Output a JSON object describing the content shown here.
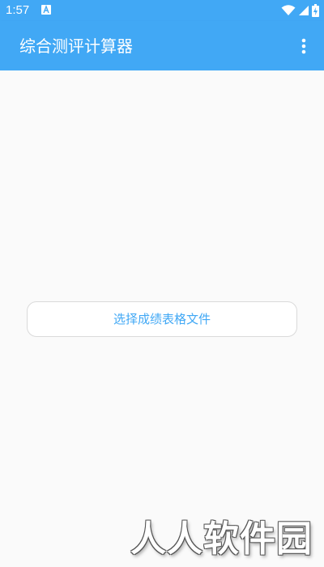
{
  "status_bar": {
    "time": "1:57",
    "notification_icon": "a-letter-icon",
    "wifi_icon": "wifi-icon",
    "signal_icon": "cell-signal-icon",
    "battery_icon": "battery-charging-icon"
  },
  "app_bar": {
    "title": "综合测评计算器",
    "overflow_icon": "more-vert-icon"
  },
  "main": {
    "select_button_label": "选择成绩表格文件"
  },
  "watermark": {
    "text": "人人软件园"
  },
  "colors": {
    "primary": "#41a8f5",
    "background": "#fafafa",
    "button_border": "#dadada",
    "button_text": "#41a8f5"
  }
}
